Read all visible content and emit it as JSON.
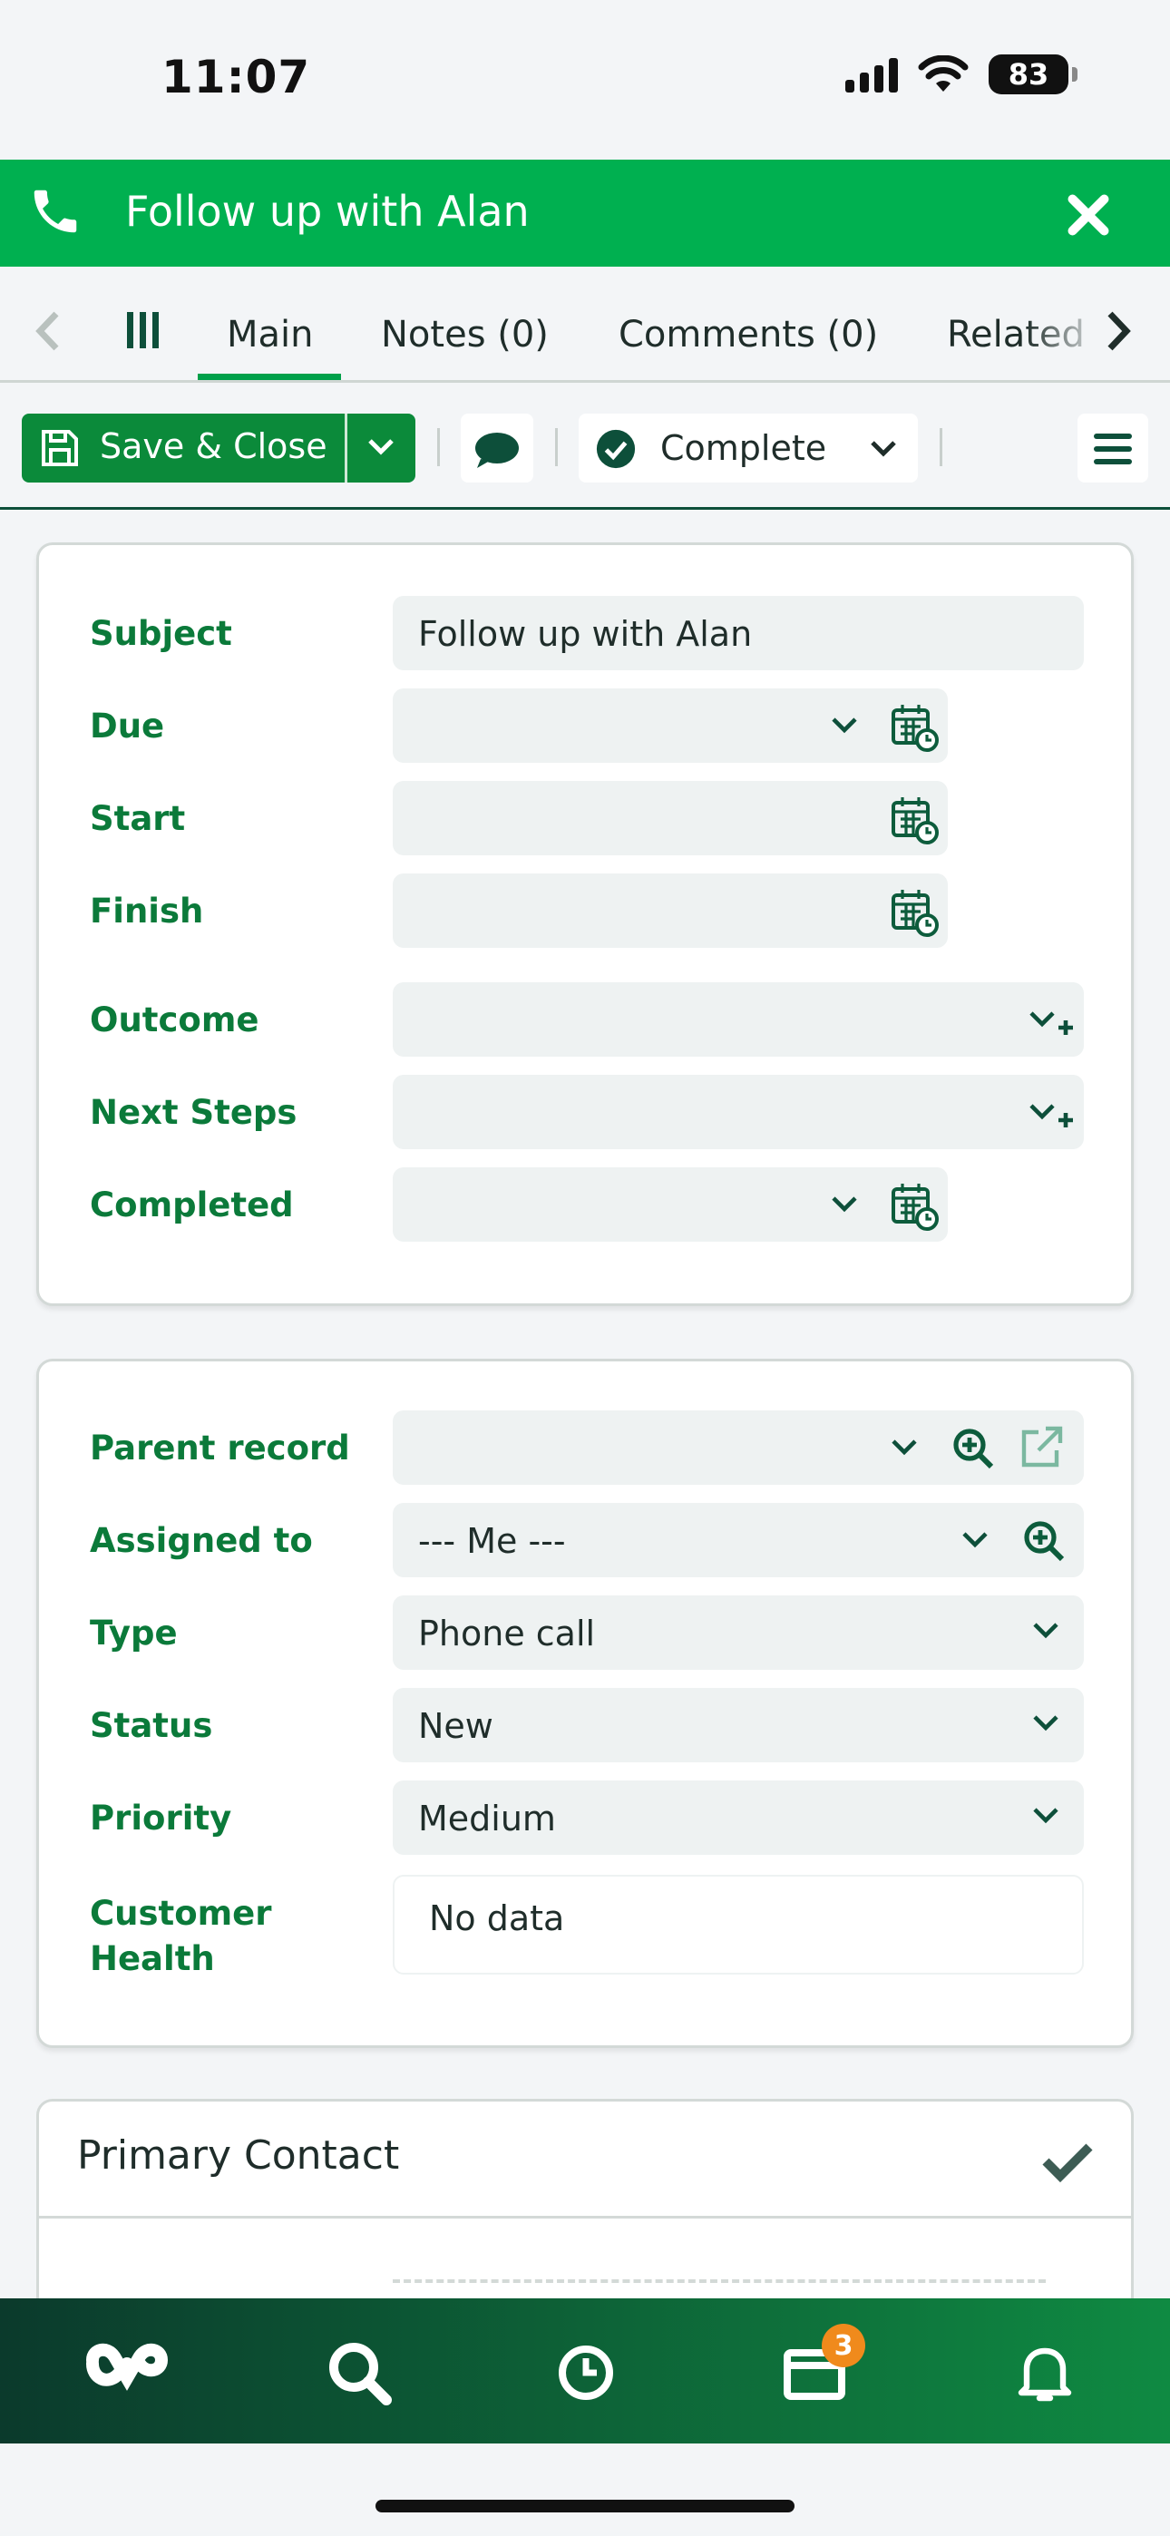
{
  "status_bar": {
    "time": "11:07",
    "battery": "83"
  },
  "header": {
    "title": "Follow up with Alan"
  },
  "tabs": [
    {
      "label": "Main",
      "active": true
    },
    {
      "label": "Notes (0)",
      "active": false
    },
    {
      "label": "Comments (0)",
      "active": false
    },
    {
      "label": "Related",
      "active": false
    }
  ],
  "toolbar": {
    "save_label": "Save & Close",
    "complete_label": "Complete"
  },
  "main_card": {
    "subject_label": "Subject",
    "subject_value": "Follow up with Alan",
    "due_label": "Due",
    "start_label": "Start",
    "finish_label": "Finish",
    "outcome_label": "Outcome",
    "next_steps_label": "Next Steps",
    "completed_label": "Completed"
  },
  "details_card": {
    "parent_label": "Parent record",
    "assigned_label": "Assigned to",
    "assigned_value": "--- Me ---",
    "type_label": "Type",
    "type_value": "Phone call",
    "status_label": "Status",
    "status_value": "New",
    "priority_label": "Priority",
    "priority_value": "Medium",
    "health_label_1": "Customer",
    "health_label_2": "Health",
    "health_value": "No data"
  },
  "primary_contact": {
    "title": "Primary Contact"
  },
  "bottom_nav": {
    "inbox_badge": "3"
  },
  "colors": {
    "brand_green": "#00b050",
    "label_green": "#0b7a3a",
    "dark_green": "#0b3a2c",
    "badge_orange": "#f08a1c"
  }
}
